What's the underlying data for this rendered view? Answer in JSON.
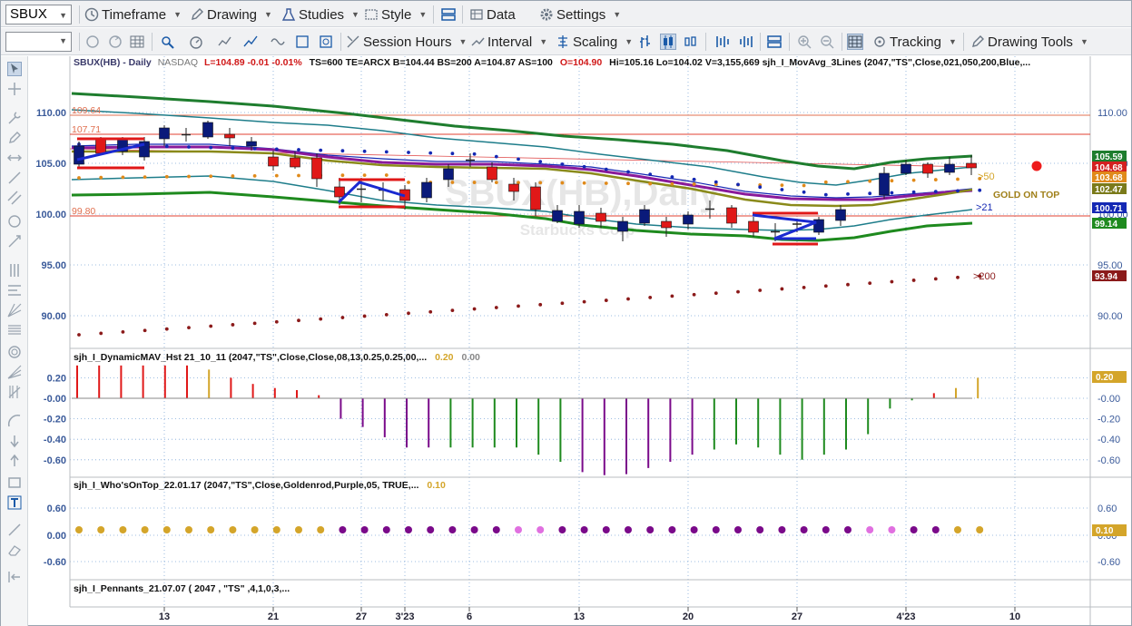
{
  "toolbar1": {
    "symbol": "SBUX",
    "items": [
      {
        "id": "timeframe",
        "label": "Timeframe"
      },
      {
        "id": "drawing",
        "label": "Drawing"
      },
      {
        "id": "studies",
        "label": "Studies"
      },
      {
        "id": "style",
        "label": "Style"
      },
      {
        "id": "data",
        "label": "Data"
      },
      {
        "id": "settings",
        "label": "Settings"
      }
    ]
  },
  "toolbar2": {
    "session_hours": "Session Hours",
    "interval": "Interval",
    "scaling": "Scaling",
    "tracking": "Tracking",
    "drawing_tools": "Drawing Tools"
  },
  "price_pane": {
    "header_symbol": "SBUX(HB) - Daily",
    "header_exchange": "NASDAQ",
    "header_quote": "L=104.89  -0.01  -0.01%",
    "header_details": "TS=600  TE=ARCX  B=104.44  BS=200  A=104.87  AS=100",
    "header_open": "O=104.90",
    "header_rest": "Hi=105.16  Lo=104.02  V=3,155,669  sjh_I_MovAvg_3Lines (2047,\"TS\",Close,021,050,200,Blue,...",
    "watermark": "SBUX(HB),Daily",
    "watermark_sub": "Starbucks Corp",
    "hline_labels": [
      "109.64",
      "107.71",
      "99.80"
    ],
    "ma_labels": [
      ">50",
      ">21",
      ">200"
    ],
    "gold_label": "GOLD ON TOP",
    "axis_ticks": [
      "110.00",
      "105.00",
      "100.00",
      "95.00",
      "90.00"
    ],
    "price_tags": [
      {
        "text": "105.59",
        "bg": "#1e7d2e"
      },
      {
        "text": "104.68",
        "bg": "#d42020"
      },
      {
        "text": "103.68",
        "bg": "#e08a1a"
      },
      {
        "text": "102.47",
        "bg": "#7a7a1a"
      },
      {
        "text": "100.71",
        "bg": "#1428b4"
      },
      {
        "text": "99.14",
        "bg": "#1e8a1e"
      },
      {
        "text": "93.94",
        "bg": "#8b1a1a"
      }
    ]
  },
  "dmav_pane": {
    "title": "sjh_I_DynamicMAV_Hst 21_10_11 (2047,\"TS\",Close,Close,08,13,0.25,0.25,00,...",
    "v1": "0.20",
    "v2": "0.00",
    "axis_ticks": [
      "0.20",
      "-0.00",
      "-0.20",
      "-0.40",
      "-0.60"
    ],
    "tag": "0.20"
  },
  "wot_pane": {
    "title": "sjh_I_Who'sOnTop_22.01.17 (2047,\"TS\",Close,Goldenrod,Purple,05, TRUE,...",
    "v1": "0.10",
    "axis_ticks": [
      "0.60",
      "0.00",
      "-0.60"
    ],
    "tag": "0.10"
  },
  "pen_pane": {
    "title": "sjh_I_Pennants_21.07.07 ( 2047 , \"TS\" ,4,1,0,3,..."
  },
  "x_axis": [
    "13",
    "21",
    "27",
    "3'23",
    "6",
    "13",
    "20",
    "27",
    "4'23",
    "10"
  ],
  "colors": {
    "bull": "#0a1a7a",
    "bear": "#e01818",
    "gold": "#d4a52a",
    "purple": "#7a0a8a",
    "green": "#1e8a1e"
  }
}
